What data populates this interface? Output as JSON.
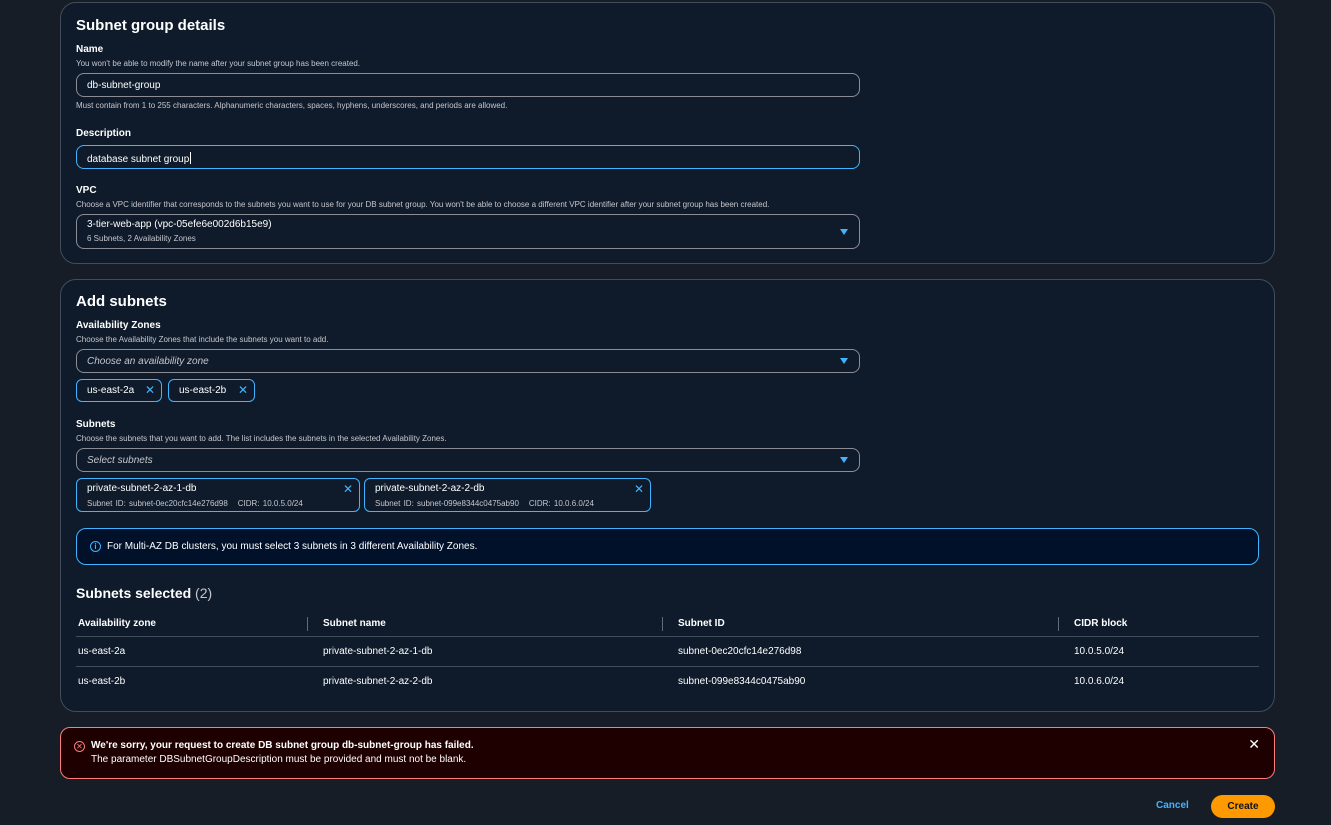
{
  "details": {
    "title": "Subnet group details",
    "name": {
      "label": "Name",
      "hint": "You won't be able to modify the name after your subnet group has been created.",
      "value": "db-subnet-group",
      "constraint": "Must contain from 1 to 255 characters. Alphanumeric characters, spaces, hyphens, underscores, and periods are allowed."
    },
    "description": {
      "label": "Description",
      "value": "database subnet group"
    },
    "vpc": {
      "label": "VPC",
      "hint": "Choose a VPC identifier that corresponds to the subnets you want to use for your DB subnet group. You won't be able to choose a different VPC identifier after your subnet group has been created.",
      "value": "3-tier-web-app (vpc-05efe6e002d6b15e9)",
      "subtext": "6 Subnets, 2 Availability Zones"
    }
  },
  "add_subnets": {
    "title": "Add subnets",
    "az": {
      "label": "Availability Zones",
      "hint": "Choose the Availability Zones that include the subnets you want to add.",
      "placeholder": "Choose an availability zone",
      "tokens": [
        "us-east-2a",
        "us-east-2b"
      ]
    },
    "subnets": {
      "label": "Subnets",
      "hint": "Choose the subnets that you want to add. The list includes the subnets in the selected Availability Zones.",
      "placeholder": "Select subnets",
      "tokens": [
        {
          "name": "private-subnet-2-az-1-db",
          "id": "Subnet ID: subnet-0ec20cfc14e276d98",
          "cidr": "CIDR: 10.0.5.0/24"
        },
        {
          "name": "private-subnet-2-az-2-db",
          "id": "Subnet ID: subnet-099e8344c0475ab90",
          "cidr": "CIDR: 10.0.6.0/24"
        }
      ]
    },
    "info": "For Multi-AZ DB clusters, you must select 3 subnets in 3 different Availability Zones."
  },
  "selected": {
    "title": "Subnets selected",
    "count": "(2)",
    "columns": [
      "Availability zone",
      "Subnet name",
      "Subnet ID",
      "CIDR block"
    ],
    "rows": [
      [
        "us-east-2a",
        "private-subnet-2-az-1-db",
        "subnet-0ec20cfc14e276d98",
        "10.0.5.0/24"
      ],
      [
        "us-east-2b",
        "private-subnet-2-az-2-db",
        "subnet-099e8344c0475ab90",
        "10.0.6.0/24"
      ]
    ]
  },
  "alert": {
    "title": "We're sorry, your request to create DB subnet group db-subnet-group has failed.",
    "message": "The parameter DBSubnetGroupDescription must be provided and must not be blank."
  },
  "actions": {
    "cancel": "Cancel",
    "create": "Create"
  },
  "icons": {
    "info": "info-icon",
    "error": "error-icon",
    "close": "close-icon",
    "dropdown": "caret-down-icon"
  },
  "colors": {
    "accent": "#42b4ff",
    "primary_button": "#ff9900",
    "error": "#ff7a7a"
  }
}
